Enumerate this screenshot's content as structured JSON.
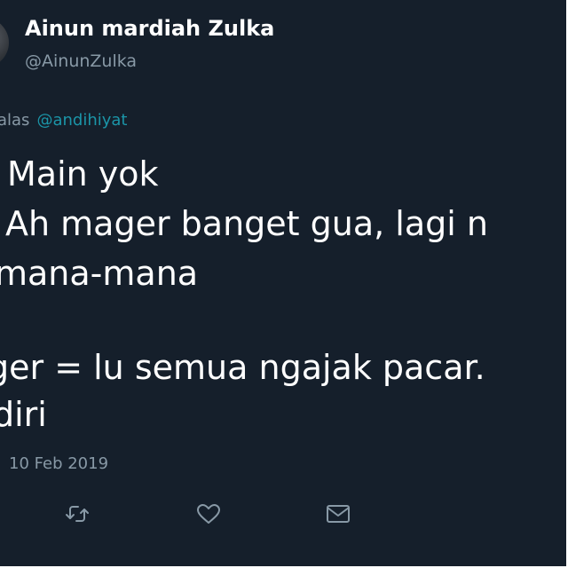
{
  "author": {
    "display_name": "Ainun mardiah Zulka",
    "handle": "@AinunZulka",
    "avatar_icon": "avatar"
  },
  "reply": {
    "prefix": "alas",
    "mention": "@andihiyat"
  },
  "tweet": {
    "lines": [
      "Main yok",
      "Ah mager banget gua, lagi n",
      "mana-mana",
      "ger = lu semua ngajak pacar.",
      "diri"
    ]
  },
  "timestamp": "10 Feb 2019",
  "actions": [
    {
      "name": "retweet",
      "icon": "retweet-icon"
    },
    {
      "name": "like",
      "icon": "heart-icon"
    },
    {
      "name": "direct-message",
      "icon": "envelope-icon"
    }
  ],
  "colors": {
    "background": "#151f2b",
    "text": "#ffffff",
    "muted": "#8899a6",
    "mention": "#1b95a8"
  }
}
